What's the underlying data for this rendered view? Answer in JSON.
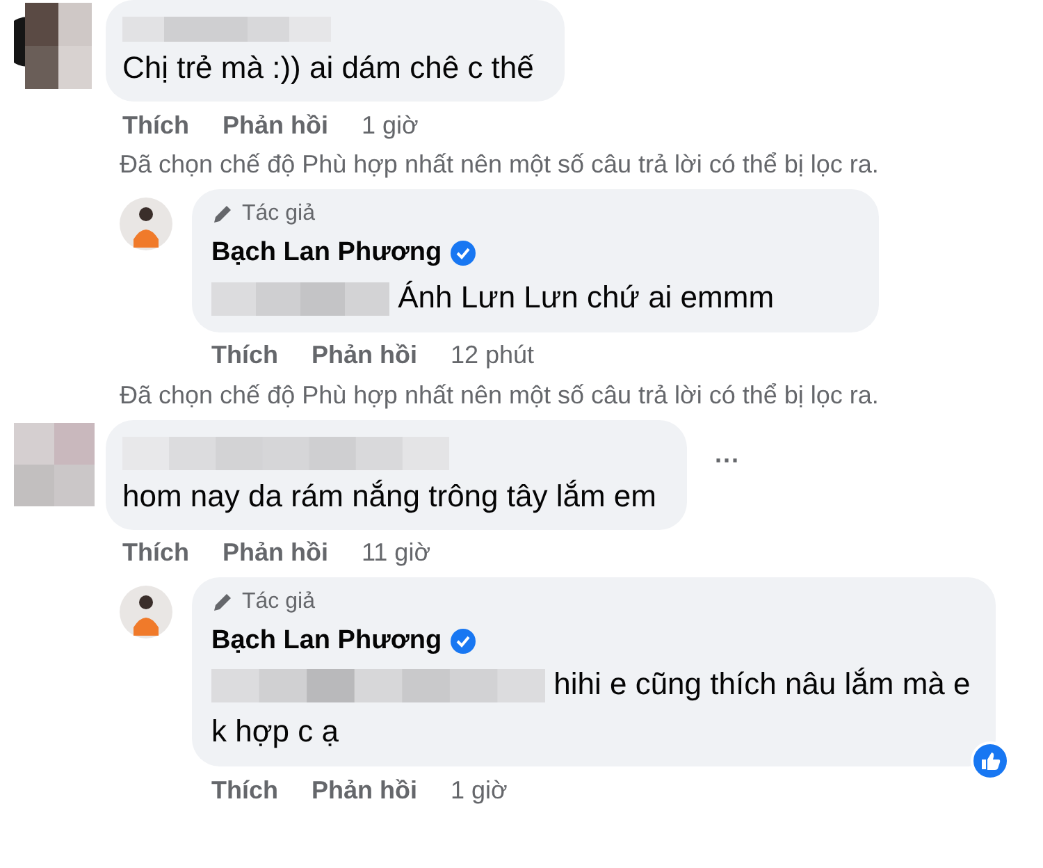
{
  "comments": [
    {
      "kind": "comment",
      "text": "Chị trẻ mà :)) ai dám chê c thế",
      "like": "Thích",
      "reply": "Phản hồi",
      "time": "1 giờ",
      "notice": "Đã chọn chế độ Phù hợp nhất nên một số câu trả lời có thể bị lọc ra."
    },
    {
      "kind": "reply",
      "badge": "Tác giả",
      "author": "Bạch Lan Phương",
      "text": "Ánh Lưn Lưn chứ ai emmm",
      "like": "Thích",
      "reply": "Phản hồi",
      "time": "12 phút",
      "reacted": false,
      "notice": "Đã chọn chế độ Phù hợp nhất nên một số câu trả lời có thể bị lọc ra."
    },
    {
      "kind": "comment",
      "text": "hom nay da rám nắng trông tây lắm em",
      "like": "Thích",
      "reply": "Phản hồi",
      "time": "11 giờ",
      "menu_label": "···"
    },
    {
      "kind": "reply",
      "badge": "Tác giả",
      "author": "Bạch Lan Phương",
      "text": "hihi e cũng thích nâu lắm mà e k hợp c ạ",
      "like": "Thích",
      "reply": "Phản hồi",
      "time": "1 giờ",
      "reacted": true
    }
  ]
}
